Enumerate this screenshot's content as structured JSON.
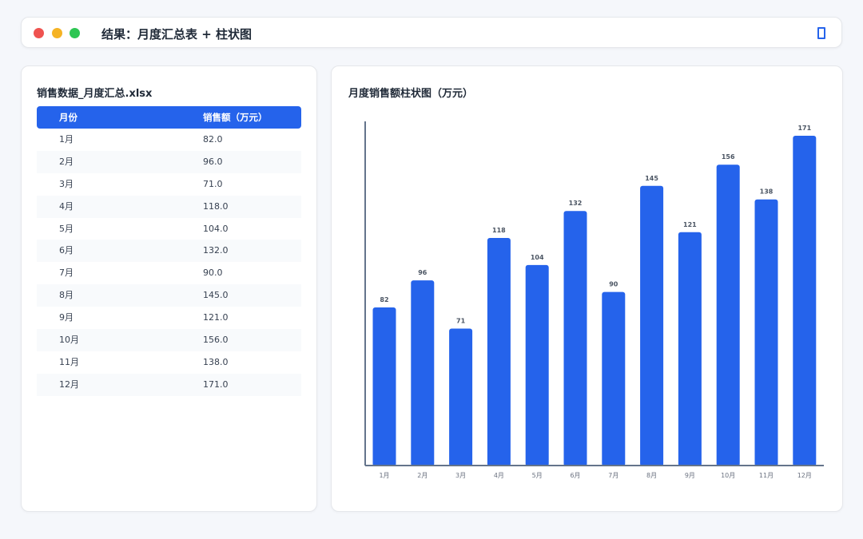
{
  "window": {
    "title": "结果：月度汇总表 + 柱状图",
    "controls": [
      "close",
      "minimize",
      "maximize"
    ],
    "corner_icon": "window-icon"
  },
  "table": {
    "title": "销售数据_月度汇总.xlsx",
    "headers": [
      "月份",
      "销售额（万元）"
    ],
    "rows": [
      [
        "1月",
        "82.0"
      ],
      [
        "2月",
        "96.0"
      ],
      [
        "3月",
        "71.0"
      ],
      [
        "4月",
        "118.0"
      ],
      [
        "5月",
        "104.0"
      ],
      [
        "6月",
        "132.0"
      ],
      [
        "7月",
        "90.0"
      ],
      [
        "8月",
        "145.0"
      ],
      [
        "9月",
        "121.0"
      ],
      [
        "10月",
        "156.0"
      ],
      [
        "11月",
        "138.0"
      ],
      [
        "12月",
        "171.0"
      ]
    ]
  },
  "colors": {
    "accent": "#2563eb",
    "axis": "#64748b",
    "background": "#f5f7fb"
  },
  "chart_data": {
    "type": "bar",
    "title": "月度销售额柱状图（万元）",
    "categories": [
      "1月",
      "2月",
      "3月",
      "4月",
      "5月",
      "6月",
      "7月",
      "8月",
      "9月",
      "10月",
      "11月",
      "12月"
    ],
    "values": [
      82,
      96,
      71,
      118,
      104,
      132,
      90,
      145,
      121,
      156,
      138,
      171
    ],
    "data_labels": [
      "82",
      "96",
      "71",
      "118",
      "104",
      "132",
      "90",
      "145",
      "121",
      "156",
      "138",
      "171"
    ],
    "xlabel": "",
    "ylabel": "",
    "ylim": [
      0,
      171
    ],
    "grid": false,
    "legend": "none",
    "bar_color": "#2563eb"
  }
}
